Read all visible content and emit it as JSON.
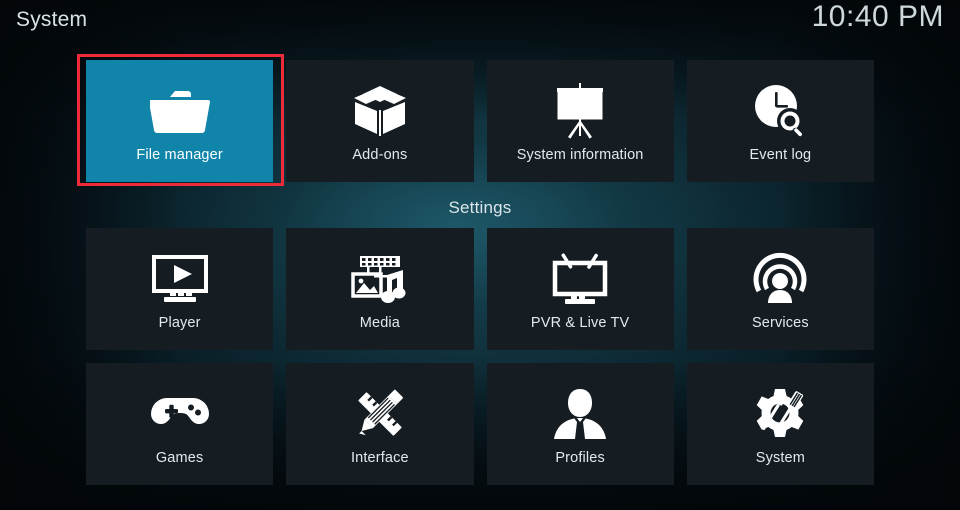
{
  "header": {
    "title": "System",
    "clock": "10:40 PM"
  },
  "section": {
    "settings_label": "Settings"
  },
  "colors": {
    "focus_background": "#1184a9",
    "tile_background": "#151d23",
    "annotation_border": "#ee2b39",
    "text": "#e2eaed",
    "background_teal": "#10323d"
  },
  "top_row": [
    {
      "label": "File manager",
      "icon": "folder-icon",
      "focused": true
    },
    {
      "label": "Add-ons",
      "icon": "open-box-icon",
      "focused": false
    },
    {
      "label": "System information",
      "icon": "presentation-icon",
      "focused": false
    },
    {
      "label": "Event log",
      "icon": "clock-search-icon",
      "focused": false
    }
  ],
  "settings_rows": [
    [
      {
        "label": "Player",
        "icon": "monitor-play-icon",
        "focused": false
      },
      {
        "label": "Media",
        "icon": "film-photo-music-icon",
        "focused": false
      },
      {
        "label": "PVR & Live TV",
        "icon": "tv-antenna-icon",
        "focused": false
      },
      {
        "label": "Services",
        "icon": "broadcast-person-icon",
        "focused": false
      }
    ],
    [
      {
        "label": "Games",
        "icon": "gamepad-icon",
        "focused": false
      },
      {
        "label": "Interface",
        "icon": "pencil-ruler-icon",
        "focused": false
      },
      {
        "label": "Profiles",
        "icon": "person-bust-icon",
        "focused": false
      },
      {
        "label": "System",
        "icon": "gear-tools-icon",
        "focused": false
      }
    ]
  ]
}
